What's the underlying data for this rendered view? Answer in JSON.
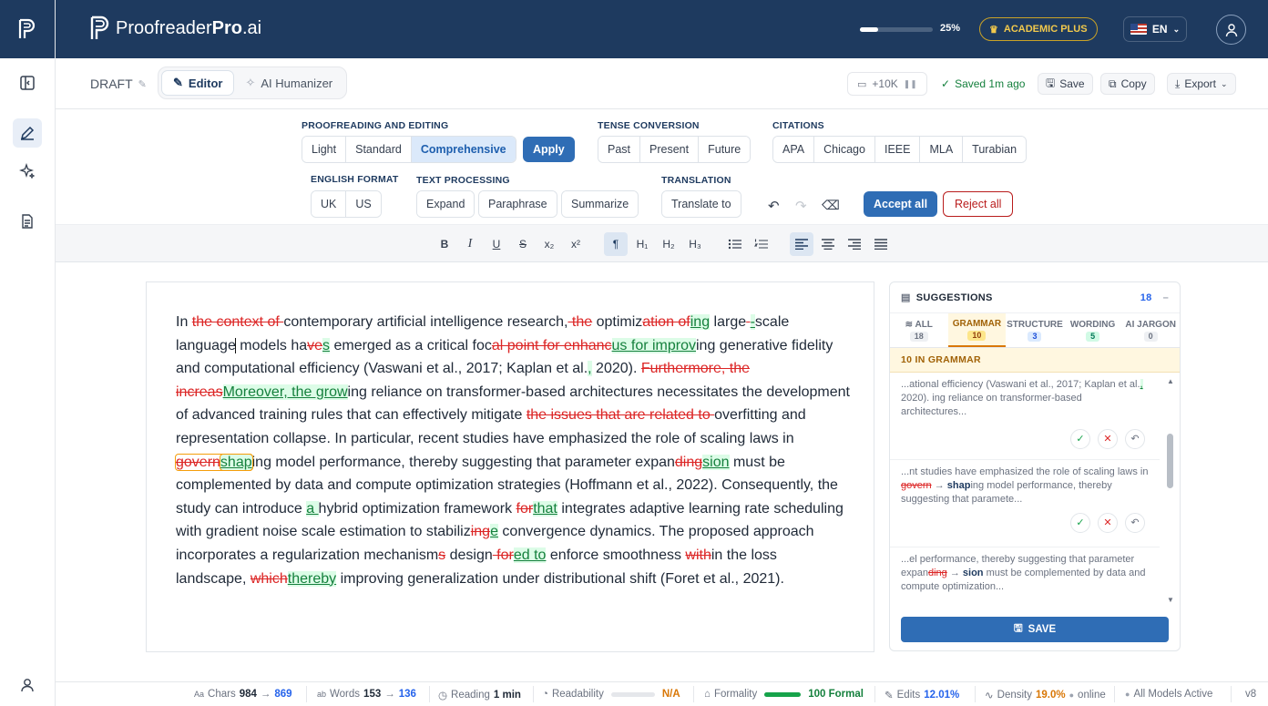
{
  "app": {
    "brand_prefix": "Proofreader",
    "brand_bold": "Pro",
    "brand_suffix": ".ai"
  },
  "topbar": {
    "progress_label": "25%",
    "progress_value": 0.25,
    "plan": "ACADEMIC PLUS",
    "lang": "EN"
  },
  "header": {
    "draft": "DRAFT",
    "modes": [
      "Editor",
      "AI Humanizer"
    ],
    "tokens": "+10K",
    "saved": "Saved 1m ago",
    "save": "Save",
    "copy": "Copy",
    "export": "Export"
  },
  "tools": {
    "proofreading_label": "PROOFREADING AND EDITING",
    "proofreading": [
      "Light",
      "Standard",
      "Comprehensive"
    ],
    "apply": "Apply",
    "tense_label": "TENSE CONVERSION",
    "tense": [
      "Past",
      "Present",
      "Future"
    ],
    "citations_label": "CITATIONS",
    "citations": [
      "APA",
      "Chicago",
      "IEEE",
      "MLA",
      "Turabian"
    ],
    "english_label": "ENGLISH FORMAT",
    "english": [
      "UK",
      "US"
    ],
    "textproc_label": "TEXT PROCESSING",
    "textproc": [
      "Expand",
      "Paraphrase",
      "Summarize"
    ],
    "translation_label": "TRANSLATION",
    "translate": "Translate to",
    "accept_all": "Accept all",
    "reject_all": "Reject all"
  },
  "format": {
    "bold": "B",
    "italic": "I",
    "underline": "U",
    "strike": "S",
    "sub": "x₂",
    "sup": "x²",
    "para": "¶",
    "h1": "H₁",
    "h2": "H₂",
    "h3": "H₃"
  },
  "document": {
    "t1": "In ",
    "d1": "the context of ",
    "t2": "contemporary artificial intelligence research,",
    "d2": " the",
    "t3": " optimiz",
    "d3": "ation of",
    "i3": "ing",
    "t4": " large",
    "d4": " ",
    "i4": "-",
    "t5": "scale language",
    "t5b": " models ha",
    "d5": "ve",
    "i5": "s",
    "t6": " emerged as a critical foc",
    "d6": "al point for enhanc",
    "i6": "us for improv",
    "t7": "ing generative fidelity and computational efficiency (Vaswani et al., 2017; Kaplan et al.",
    "i7": ",",
    "t8": " 2020). ",
    "d8": "Furthermore, the increas",
    "i8": "Moreover, the grow",
    "t9": "ing reliance on transformer-based architectures necessitates the development of advanced training rules that can effectively mitigate ",
    "d9": "the issues that are related to ",
    "t10": "overfitting and representation collapse. In particular, recent studies have emphasized the role of scaling laws in ",
    "d10": "govern",
    "i10": "shap",
    "t11": "ing model performance, thereby suggesting that parameter expan",
    "d11": "ding",
    "i11": "sion",
    "t12": " must be complemented by data and compute optimization strategies (Hoffmann et al., 2022). Consequently, the study can introduce ",
    "i12": "a ",
    "t13": "hybrid optimization framework ",
    "d13": "for",
    "i13": "that",
    "t14": " integrates adaptive learning rate scheduling with gradient noise scale estimation to stabiliz",
    "d14": "ing",
    "i14": "e",
    "t15": " convergence dynamics. The proposed approach incorporates a regularization mechanism",
    "d15": "s",
    "t16": " design",
    "d16": " for",
    "i16": "ed to",
    "t17": " enforce smoothness ",
    "d17": "with",
    "t18": "in the loss landscape, ",
    "d18": "which",
    "i18": "thereby",
    "t19": " improving generalization under distributional shift (Foret et al., 2021)."
  },
  "suggestions": {
    "title": "SUGGESTIONS",
    "count": "18",
    "tabs": [
      {
        "label": "ALL",
        "count": "18"
      },
      {
        "label": "GRAMMAR",
        "count": "10"
      },
      {
        "label": "STRUCTURE",
        "count": "3"
      },
      {
        "label": "WORDING",
        "count": "5"
      },
      {
        "label": "AI JARGON",
        "count": "0"
      }
    ],
    "category": "10 IN GRAMMAR",
    "cards": [
      {
        "pre": "...ational efficiency (Vaswani et al., 2017; Kaplan et al.",
        "ins": ",",
        "post": " 2020). ing reliance on transformer-based architectures..."
      },
      {
        "pre": "...nt studies have emphasized the role of scaling laws in ",
        "del": "govern",
        "arrow": "→",
        "ins": "shap",
        "post": "ing model performance, thereby suggesting that paramete..."
      },
      {
        "pre": "...el performance, thereby suggesting that parameter expan",
        "del": "ding",
        "arrow": "→",
        "ins": "sion",
        "post": " must be complemented by data and compute optimization..."
      }
    ],
    "save": "SAVE"
  },
  "status": {
    "chars_label": "Chars",
    "chars_from": "984",
    "chars_to": "869",
    "words_label": "Words",
    "words_from": "153",
    "words_to": "136",
    "reading_label": "Reading",
    "reading": "1 min",
    "readability_label": "Readability",
    "readability": "N/A",
    "formality_label": "Formality",
    "formality": "100 Formal",
    "formality_value": 1.0,
    "edits_label": "Edits",
    "edits": "12.01%",
    "density_label": "Density",
    "density": "19.0%",
    "online": "online",
    "models": "All Models Active",
    "version": "v8"
  },
  "colors": {
    "navy": "#1e3a5f",
    "accent": "#2f6db5",
    "insert": "#15803d",
    "delete": "#dc2626",
    "gold": "#c9a227"
  }
}
